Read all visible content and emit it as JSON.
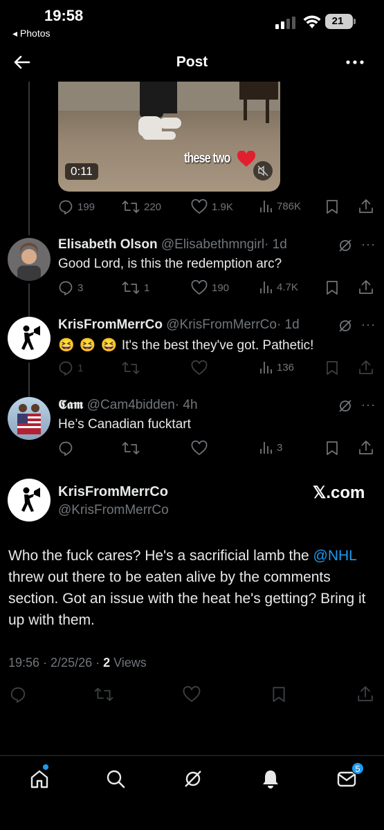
{
  "status_bar": {
    "time": "19:58",
    "back_app": "◂ Photos",
    "battery": "21"
  },
  "header": {
    "title": "Post"
  },
  "video": {
    "duration": "0:11",
    "caption": "these two"
  },
  "video_stats": {
    "replies": "199",
    "reposts": "220",
    "likes": "1.9K",
    "views": "786K"
  },
  "replies": [
    {
      "name": "Elisabeth Olson",
      "handle": "@Elisabethmngirl",
      "time": "· 1d",
      "text": "Good Lord, is this the redemption arc?",
      "replies": "3",
      "reposts": "1",
      "likes": "190",
      "views": "4.7K"
    },
    {
      "name": "KrisFromMerrCo",
      "handle": "@KrisFromMerrCo",
      "time": "· 1d",
      "emoji": "😆 😆 😆",
      "text": "It's the best they've got. Pathetic!",
      "replies": "1",
      "reposts": "",
      "likes": "",
      "views": "136"
    },
    {
      "name": "𝕮𝖆𝖒",
      "handle": "@Cam4bidden",
      "time": "· 4h",
      "text": "He’s Canadian fucktart",
      "replies": "",
      "reposts": "",
      "likes": "",
      "views": "3"
    }
  ],
  "main_post": {
    "name": "KrisFromMerrCo",
    "handle": "@KrisFromMerrCo",
    "watermark": "𝕏.com",
    "body_before": "Who the fuck cares? He's a sacrificial lamb the ",
    "mention": "@NHL",
    "body_after": " threw out there to be eaten alive by the comments section. Got an issue with the heat he's getting? Bring it up with them.",
    "meta_time": "19:56 · 2/25/26 · ",
    "views_count": "2",
    "views_label": " Views"
  },
  "nav": {
    "messages_badge": "5"
  },
  "colors": {
    "accent": "#1d9bf0",
    "muted": "#71767b",
    "background": "#000000"
  },
  "icons": [
    "back-arrow-icon",
    "more-icon",
    "reply-icon",
    "repost-icon",
    "like-icon",
    "views-icon",
    "bookmark-icon",
    "share-icon",
    "grok-icon",
    "mute-icon",
    "home-icon",
    "search-icon",
    "bell-icon",
    "mail-icon"
  ]
}
